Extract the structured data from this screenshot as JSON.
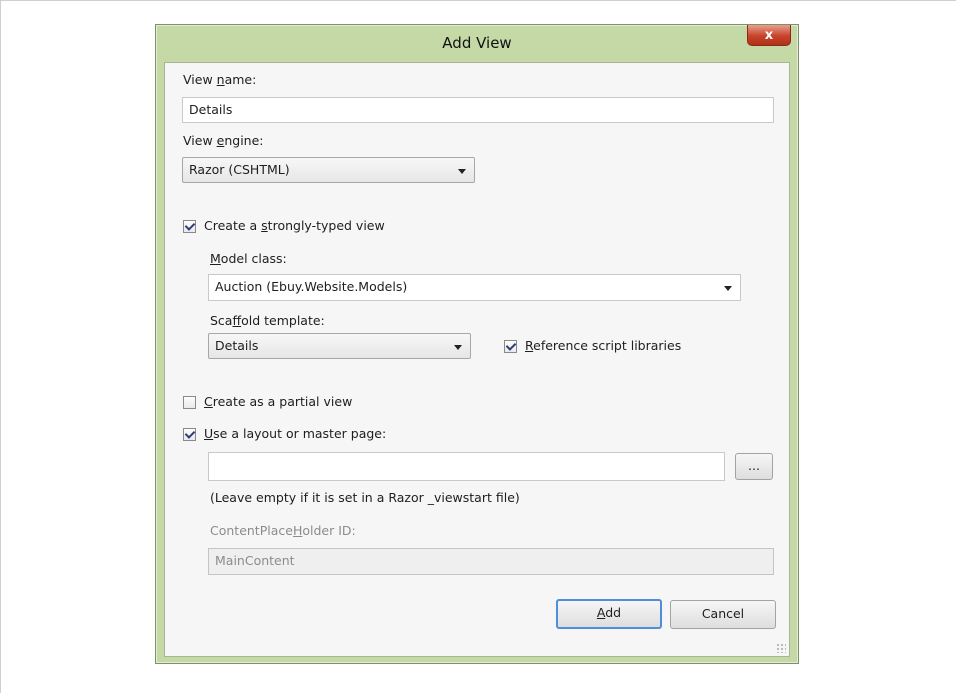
{
  "dialog": {
    "title": "Add View",
    "close_glyph": "x",
    "view_name": {
      "label_pre": "View ",
      "label_key": "n",
      "label_post": "ame:",
      "value": "Details"
    },
    "view_engine": {
      "label_pre": "View ",
      "label_key": "e",
      "label_post": "ngine:",
      "value": "Razor (CSHTML)"
    },
    "strongly_typed": {
      "label_pre": "Create a ",
      "label_key": "s",
      "label_post": "trongly-typed view",
      "checked": true
    },
    "model_class": {
      "label_pre": "",
      "label_key": "M",
      "label_post": "odel class:",
      "value": "Auction (Ebuy.Website.Models)"
    },
    "scaffold_template": {
      "label_pre": "Sca",
      "label_key": "f",
      "label_post": "fold template:",
      "value": "Details"
    },
    "reference_scripts": {
      "label_pre": "",
      "label_key": "R",
      "label_post": "eference script libraries",
      "checked": true
    },
    "partial_view": {
      "label_pre": "",
      "label_key": "C",
      "label_post": "reate as a partial view",
      "checked": false
    },
    "use_layout": {
      "label_pre": "",
      "label_key": "U",
      "label_post": "se a layout or master page:",
      "checked": true
    },
    "layout_path": {
      "value": ""
    },
    "browse_label": "...",
    "layout_hint": "(Leave empty if it is set in a Razor _viewstart file)",
    "content_placeholder": {
      "label_pre": "ContentPlace",
      "label_key": "H",
      "label_post": "older ID:",
      "value": "MainContent"
    },
    "add_button": {
      "label_key": "A",
      "label_post": "dd"
    },
    "cancel_button": "Cancel"
  },
  "colors": {
    "frame": "#c4d9a6",
    "close_button": "#c7432a",
    "default_button_border": "#4f8fd7"
  }
}
